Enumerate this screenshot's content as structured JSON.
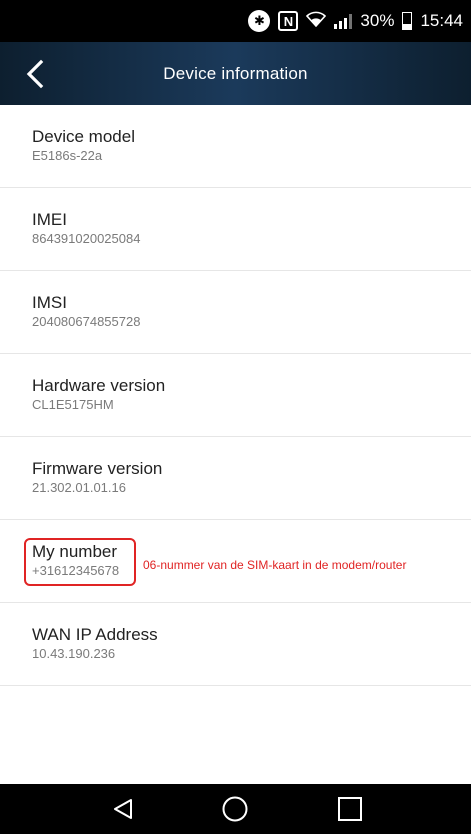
{
  "status_bar": {
    "battery": "30%",
    "time": "15:44",
    "icons": [
      "bluetooth-icon",
      "nfc-icon",
      "wifi-icon",
      "signal-icon",
      "battery-icon"
    ]
  },
  "app_bar": {
    "title": "Device information",
    "back_icon": "chevron-left-icon"
  },
  "items": [
    {
      "title": "Device model",
      "value": "E5186s-22a"
    },
    {
      "title": "IMEI",
      "value": "864391020025084"
    },
    {
      "title": "IMSI",
      "value": "204080674855728"
    },
    {
      "title": "Hardware version",
      "value": "CL1E5175HM"
    },
    {
      "title": "Firmware version",
      "value": "21.302.01.01.16"
    },
    {
      "title": "My number",
      "value": "+31612345678"
    },
    {
      "title": "WAN IP Address",
      "value": "10.43.190.236"
    }
  ],
  "annotation": {
    "text": "06-nummer van de SIM-kaart in de modem/router",
    "color": "#e02424"
  },
  "colors": {
    "app_bar": "#1b3a5b",
    "title_text": "#222222",
    "value_text": "#7a7a7a",
    "highlight": "#e02424"
  },
  "nav_bar": {
    "buttons": [
      "back-triangle-icon",
      "home-circle-icon",
      "recents-square-icon"
    ]
  }
}
